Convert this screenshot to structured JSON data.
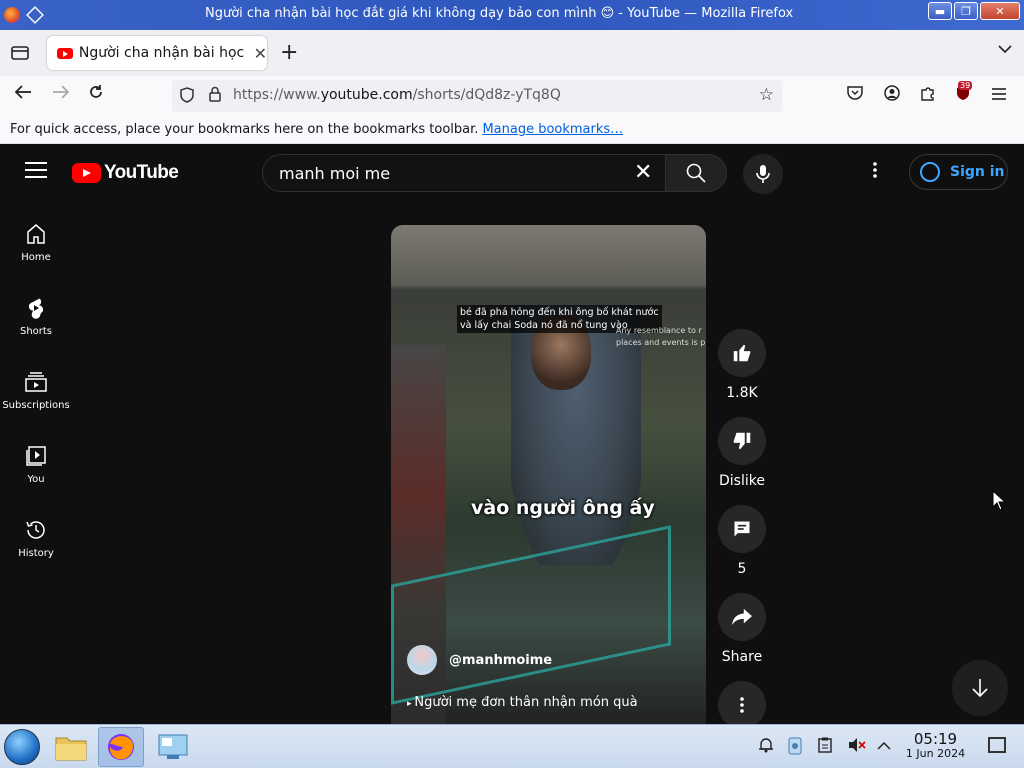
{
  "window": {
    "title": "Người cha nhận bài học đắt giá khi không dạy bảo con mình 😊 - YouTube — Mozilla Firefox"
  },
  "browser": {
    "tab_title": "Người cha nhận bài học đ",
    "url_prefix": "https://www.",
    "url_domain": "youtube.com",
    "url_path": "/shorts/dQd8z-yTq8Q",
    "extension_badge": "39",
    "bookmarks_message": "For quick access, place your bookmarks here on the bookmarks toolbar.",
    "bookmarks_link": "Manage bookmarks…"
  },
  "youtube": {
    "logo_text": "YouTube",
    "search_value": "manh moi me",
    "sign_in": "Sign in",
    "nav": [
      {
        "label": "Home",
        "icon": "home-icon"
      },
      {
        "label": "Shorts",
        "icon": "shorts-icon"
      },
      {
        "label": "Subscriptions",
        "icon": "subscriptions-icon"
      },
      {
        "label": "You",
        "icon": "you-icon"
      },
      {
        "label": "History",
        "icon": "history-icon"
      }
    ],
    "short": {
      "caption_top_1": "bé đã phá hỏng đến khi ông bố khát nước",
      "caption_top_2": "và lấy chai Soda nó đã nổ tung vào",
      "watermark_1": "Any resemblance to r",
      "watermark_2": "places and events is p",
      "caption_big": "vào người ông ấy",
      "channel": "@manhmoime",
      "description": "Người mẹ đơn thân nhận món quà"
    },
    "actions": {
      "like_count": "1.8K",
      "dislike_label": "Dislike",
      "comment_count": "5",
      "share_label": "Share"
    }
  },
  "taskbar": {
    "time": "05:19",
    "date": "1 Jun 2024"
  },
  "colors": {
    "yt_red": "#ff0000",
    "yt_bg": "#0f0f0f",
    "sign_in_blue": "#3ea6ff",
    "firefox_link": "#0061e0"
  }
}
